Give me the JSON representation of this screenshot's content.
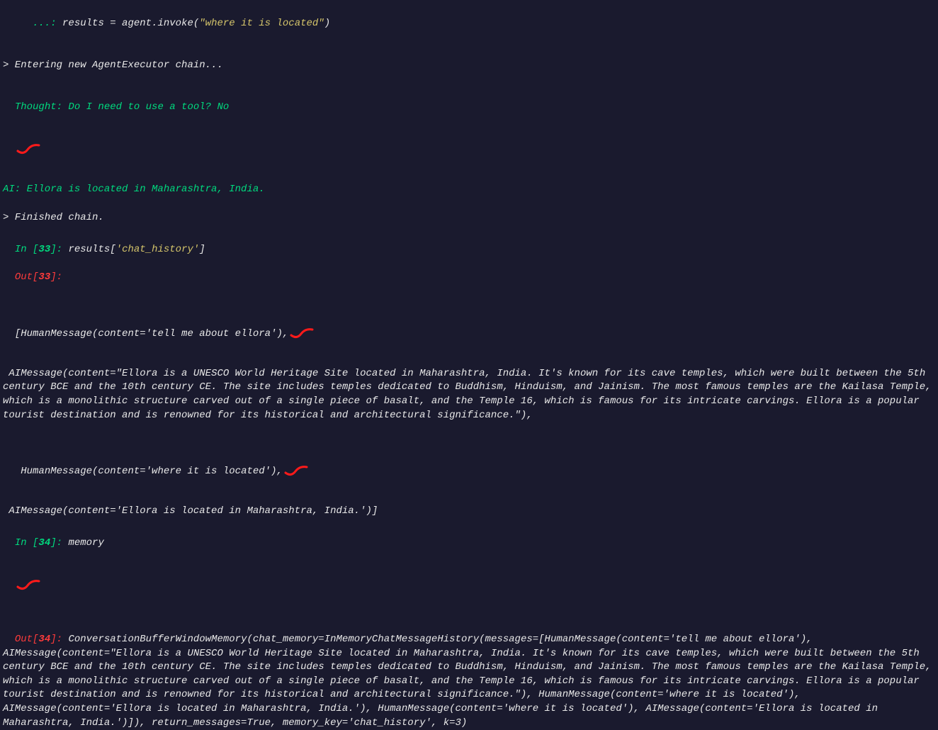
{
  "line_dots": "   ...: ",
  "line_invoke_pre": "results = agent.invoke(",
  "line_invoke_arg": "\"where it is located\"",
  "line_invoke_post": ")",
  "entering": "> Entering new AgentExecutor chain...",
  "thought": "Thought: Do I need to use a tool? No",
  "ai_line": "AI: Ellora is located in Maharashtra, India.",
  "finished": "> Finished chain.",
  "in33_prompt": "In [",
  "in33_num": "33",
  "in33_close": "]: ",
  "in33_code_pre": "results[",
  "in33_code_key": "'chat_history'",
  "in33_code_post": "]",
  "out33_prompt": "Out[",
  "out33_num": "33",
  "out33_close": "]:",
  "out33_l1": "[HumanMessage(content='tell me about ellora'),",
  "out33_l2": " AIMessage(content=\"Ellora is a UNESCO World Heritage Site located in Maharashtra, India. It's known for its cave temples, which were built between the 5th century BCE and the 10th century CE. The site includes temples dedicated to Buddhism, Hinduism, and Jainism. The most famous temples are the Kailasa Temple, which is a monolithic structure carved out of a single piece of basalt, and the Temple 16, which is famous for its intricate carvings. Ellora is a popular tourist destination and is renowned for its historical and architectural significance.\"),",
  "out33_l3": " HumanMessage(content='where it is located'),",
  "out33_l4": " AIMessage(content='Ellora is located in Maharashtra, India.')]",
  "in34_num": "34",
  "in34_code": "memory",
  "out34_body": " ConversationBufferWindowMemory(chat_memory=InMemoryChatMessageHistory(messages=[HumanMessage(content='tell me about ellora'), AIMessage(content=\"Ellora is a UNESCO World Heritage Site located in Maharashtra, India. It's known for its cave temples, which were built between the 5th century BCE and the 10th century CE. The site includes temples dedicated to Buddhism, Hinduism, and Jainism. The most famous temples are the Kailasa Temple, which is a monolithic structure carved out of a single piece of basalt, and the Temple 16, which is famous for its intricate carvings. Ellora is a popular tourist destination and is renowned for its historical and architectural significance.\"), HumanMessage(content='where it is located'), AIMessage(content='Ellora is located in Maharashtra, India.'), HumanMessage(content='where it is located'), AIMessage(content='Ellora is located in Maharashtra, India.')]), return_messages=True, memory_key='chat_history', k=3)"
}
